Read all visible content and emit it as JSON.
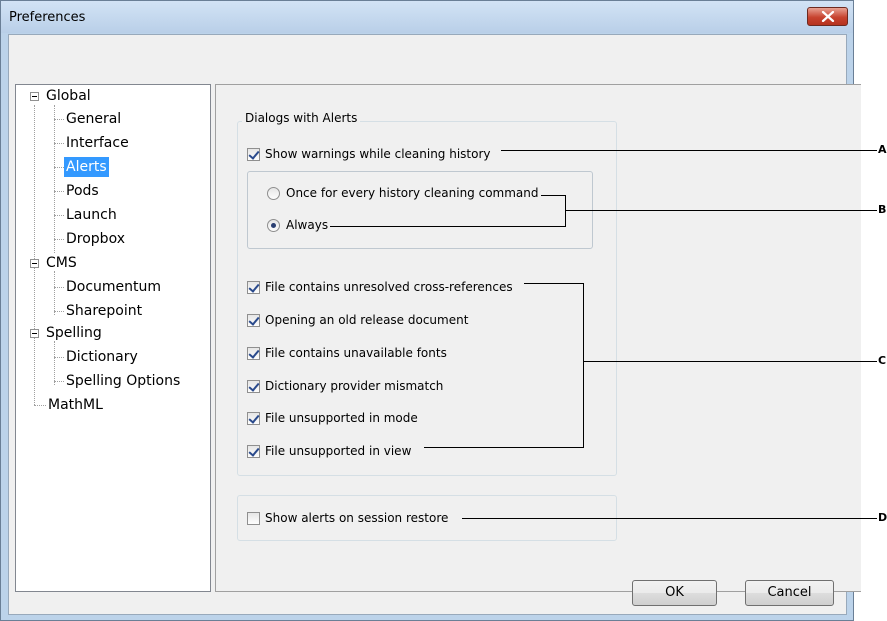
{
  "window": {
    "title": "Preferences"
  },
  "tree": [
    {
      "label": "Global"
    },
    {
      "label": "General"
    },
    {
      "label": "Interface"
    },
    {
      "label": "Alerts"
    },
    {
      "label": "Pods"
    },
    {
      "label": "Launch"
    },
    {
      "label": "Dropbox"
    },
    {
      "label": "CMS"
    },
    {
      "label": "Documentum"
    },
    {
      "label": "Sharepoint"
    },
    {
      "label": "Spelling"
    },
    {
      "label": "Dictionary"
    },
    {
      "label": "Spelling Options"
    },
    {
      "label": "MathML"
    }
  ],
  "dialogs_group": {
    "title": "Dialogs with Alerts",
    "show_warnings": {
      "label": "Show warnings while cleaning history",
      "checked": true
    },
    "radios": [
      {
        "label": "Once for every history cleaning command",
        "checked": false
      },
      {
        "label": "Always",
        "checked": true
      }
    ],
    "alerts": [
      {
        "label": "File contains unresolved cross-references",
        "checked": true
      },
      {
        "label": "Opening an old release document",
        "checked": true
      },
      {
        "label": "File contains unavailable fonts",
        "checked": true
      },
      {
        "label": "Dictionary provider mismatch",
        "checked": true
      },
      {
        "label": "File unsupported in mode",
        "checked": true
      },
      {
        "label": "File unsupported in view",
        "checked": true
      }
    ]
  },
  "session_restore": {
    "label": "Show alerts on session restore",
    "checked": false
  },
  "buttons": {
    "ok": "OK",
    "cancel": "Cancel"
  },
  "callouts": {
    "a": "A",
    "b": "B",
    "c": "C",
    "d": "D"
  }
}
